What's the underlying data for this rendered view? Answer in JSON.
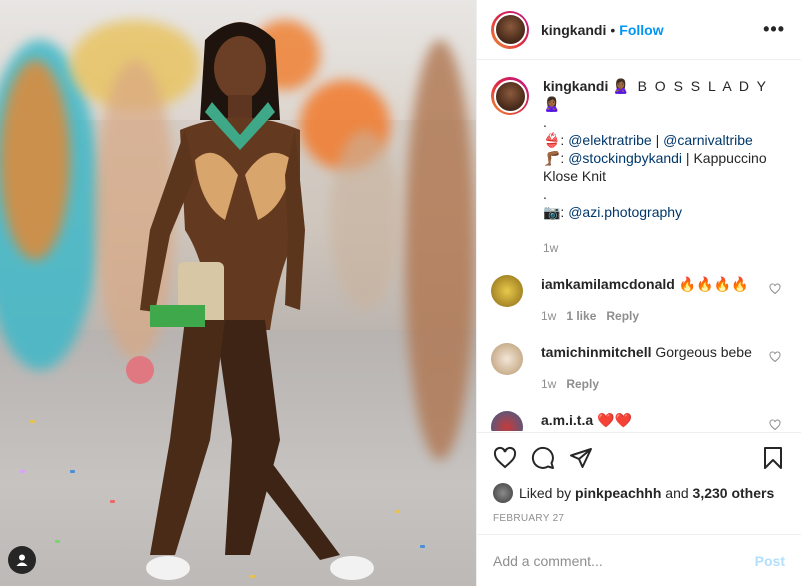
{
  "post": {
    "username": "kingkandi",
    "separator": "•",
    "follow_label": "Follow",
    "more_icon": "more-options-icon"
  },
  "caption": {
    "username": "kingkandi",
    "title": "🙎🏾‍♀️ B O S S L A D Y 🙎🏾‍♀️",
    "dot1": ".",
    "line1_prefix": "👙: ",
    "line1_link1": "@elektratribe",
    "line1_sep": " | ",
    "line1_link2": "@carnivaltribe",
    "line2_prefix": "🦵🏾: ",
    "line2_link": "@stockingbykandi",
    "line2_suffix": " | Kappuccino Klose Knit",
    "dot2": ".",
    "line3_prefix": "📷: ",
    "line3_link": "@azi.photography",
    "time": "1w"
  },
  "comments": [
    {
      "username": "iamkamilamcdonald",
      "text": "🔥🔥🔥🔥",
      "time": "1w",
      "likes": "1 like",
      "reply": "Reply",
      "avatar_color": "#c9a227"
    },
    {
      "username": "tamichinmitchell",
      "text": "Gorgeous bebe",
      "time": "1w",
      "likes": "",
      "reply": "Reply",
      "avatar_color": "#d8c3a8"
    },
    {
      "username": "a.m.i.t.a",
      "text": "❤️❤️",
      "time": "",
      "likes": "",
      "reply": "",
      "avatar_color": "#6b8fb8"
    }
  ],
  "likes": {
    "prefix": "Liked by ",
    "user": "pinkpeachhh",
    "mid": " and ",
    "count": "3,230 others"
  },
  "date": "FEBRUARY 27",
  "add_comment": {
    "placeholder": "Add a comment...",
    "post_label": "Post"
  },
  "colors": {
    "accent": "#0095f6",
    "muted": "#8e8e8e",
    "post_disabled": "#b2dffc"
  }
}
